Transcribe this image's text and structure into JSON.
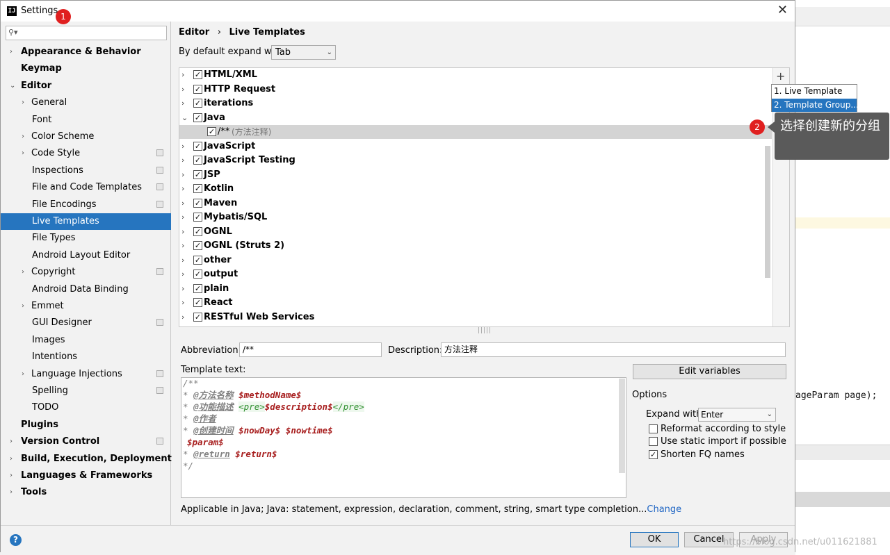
{
  "window": {
    "title": "Settings",
    "close_glyph": "✕"
  },
  "annotations": {
    "step1": "1",
    "step2": "2",
    "tooltip": "选择创建新的分组"
  },
  "sidebar": {
    "items": [
      {
        "label": "Appearance & Behavior",
        "bold": true,
        "arrow": "›"
      },
      {
        "label": "Keymap",
        "bold": true,
        "arrow": ""
      },
      {
        "label": "Editor",
        "bold": true,
        "arrow": "⌄"
      },
      {
        "label": "General",
        "arrow": "›"
      },
      {
        "label": "Font",
        "arrow": ""
      },
      {
        "label": "Color Scheme",
        "arrow": "›"
      },
      {
        "label": "Code Style",
        "arrow": "›",
        "copy_icon": true
      },
      {
        "label": "Inspections",
        "arrow": "",
        "copy_icon": true
      },
      {
        "label": "File and Code Templates",
        "arrow": "",
        "copy_icon": true
      },
      {
        "label": "File Encodings",
        "arrow": "",
        "copy_icon": true
      },
      {
        "label": "Live Templates",
        "arrow": "",
        "selected": true
      },
      {
        "label": "File Types",
        "arrow": ""
      },
      {
        "label": "Android Layout Editor",
        "arrow": ""
      },
      {
        "label": "Copyright",
        "arrow": "›",
        "copy_icon": true
      },
      {
        "label": "Android Data Binding",
        "arrow": ""
      },
      {
        "label": "Emmet",
        "arrow": "›"
      },
      {
        "label": "GUI Designer",
        "arrow": "",
        "copy_icon": true
      },
      {
        "label": "Images",
        "arrow": ""
      },
      {
        "label": "Intentions",
        "arrow": ""
      },
      {
        "label": "Language Injections",
        "arrow": "›",
        "copy_icon": true
      },
      {
        "label": "Spelling",
        "arrow": "",
        "copy_icon": true
      },
      {
        "label": "TODO",
        "arrow": ""
      },
      {
        "label": "Plugins",
        "bold": true,
        "arrow": ""
      },
      {
        "label": "Version Control",
        "bold": true,
        "arrow": "›",
        "copy_icon": true
      },
      {
        "label": "Build, Execution, Deployment",
        "bold": true,
        "arrow": "›"
      },
      {
        "label": "Languages & Frameworks",
        "bold": true,
        "arrow": "›"
      },
      {
        "label": "Tools",
        "bold": true,
        "arrow": "›"
      }
    ]
  },
  "breadcrumb": {
    "parent": "Editor",
    "sep": "›",
    "current": "Live Templates"
  },
  "expand": {
    "label": "By default expand with",
    "value": "Tab"
  },
  "tree": {
    "groups": [
      {
        "name": "HTML/XML",
        "checked": true
      },
      {
        "name": "HTTP Request",
        "checked": true
      },
      {
        "name": "iterations",
        "checked": true
      },
      {
        "name": "Java",
        "checked": true,
        "expanded": true
      },
      {
        "name": "/**",
        "desc": "(方法注释)",
        "checked": true,
        "child": true
      },
      {
        "name": "JavaScript",
        "checked": true
      },
      {
        "name": "JavaScript Testing",
        "checked": true
      },
      {
        "name": "JSP",
        "checked": true
      },
      {
        "name": "Kotlin",
        "checked": true
      },
      {
        "name": "Maven",
        "checked": true
      },
      {
        "name": "Mybatis/SQL",
        "checked": true
      },
      {
        "name": "OGNL",
        "checked": true
      },
      {
        "name": "OGNL (Struts 2)",
        "checked": true
      },
      {
        "name": "other",
        "checked": true
      },
      {
        "name": "output",
        "checked": true
      },
      {
        "name": "plain",
        "checked": true
      },
      {
        "name": "React",
        "checked": true
      },
      {
        "name": "RESTful Web Services",
        "checked": true
      }
    ],
    "add_glyph": "+"
  },
  "popup": {
    "items": [
      "1. Live Template",
      "2. Template Group..."
    ]
  },
  "editor": {
    "abbreviation_label": "Abbreviation:",
    "abbreviation_value": "/**",
    "description_label": "Description:",
    "description_value": "方法注释",
    "template_label": "Template text:",
    "template_lines": {
      "l1": "/**",
      "l2_prefix": " * ",
      "l2_tag": "@方法名称",
      "l2_var": "$methodName$",
      "l3_prefix": " * ",
      "l3_tag": "@功能描述",
      "l3_pre_open": "<pre>",
      "l3_var": "$description$",
      "l3_pre_close": "</pre>",
      "l4_prefix": " * ",
      "l4_tag": "@作者",
      "l5_prefix": " * ",
      "l5_tag": "@创建时间",
      "l5_var1": "$nowDay$",
      "l5_var2": "$nowtime$",
      "l6": "$param$",
      "l7_prefix": " * ",
      "l7_tag": "@return",
      "l7_var": "$return$",
      "l8": " */"
    },
    "applicable_text": "Applicable in Java; Java: statement, expression, declaration, comment, string, smart type completion...",
    "change_link": "Change"
  },
  "options": {
    "edit_variables": "Edit variables",
    "title": "Options",
    "expand_with_label": "Expand with",
    "expand_with_value": "Enter",
    "reformat": {
      "label": "Reformat according to style",
      "checked": false
    },
    "static_import": {
      "label": "Use static import if possible",
      "checked": false
    },
    "shorten_fq": {
      "label": "Shorten FQ names",
      "checked": true
    }
  },
  "footer": {
    "ok": "OK",
    "cancel": "Cancel",
    "apply": "Apply",
    "help": "?"
  },
  "background": {
    "code_fragment": "ageParam page);"
  },
  "watermark": "https://blog.csdn.net/u011621881"
}
